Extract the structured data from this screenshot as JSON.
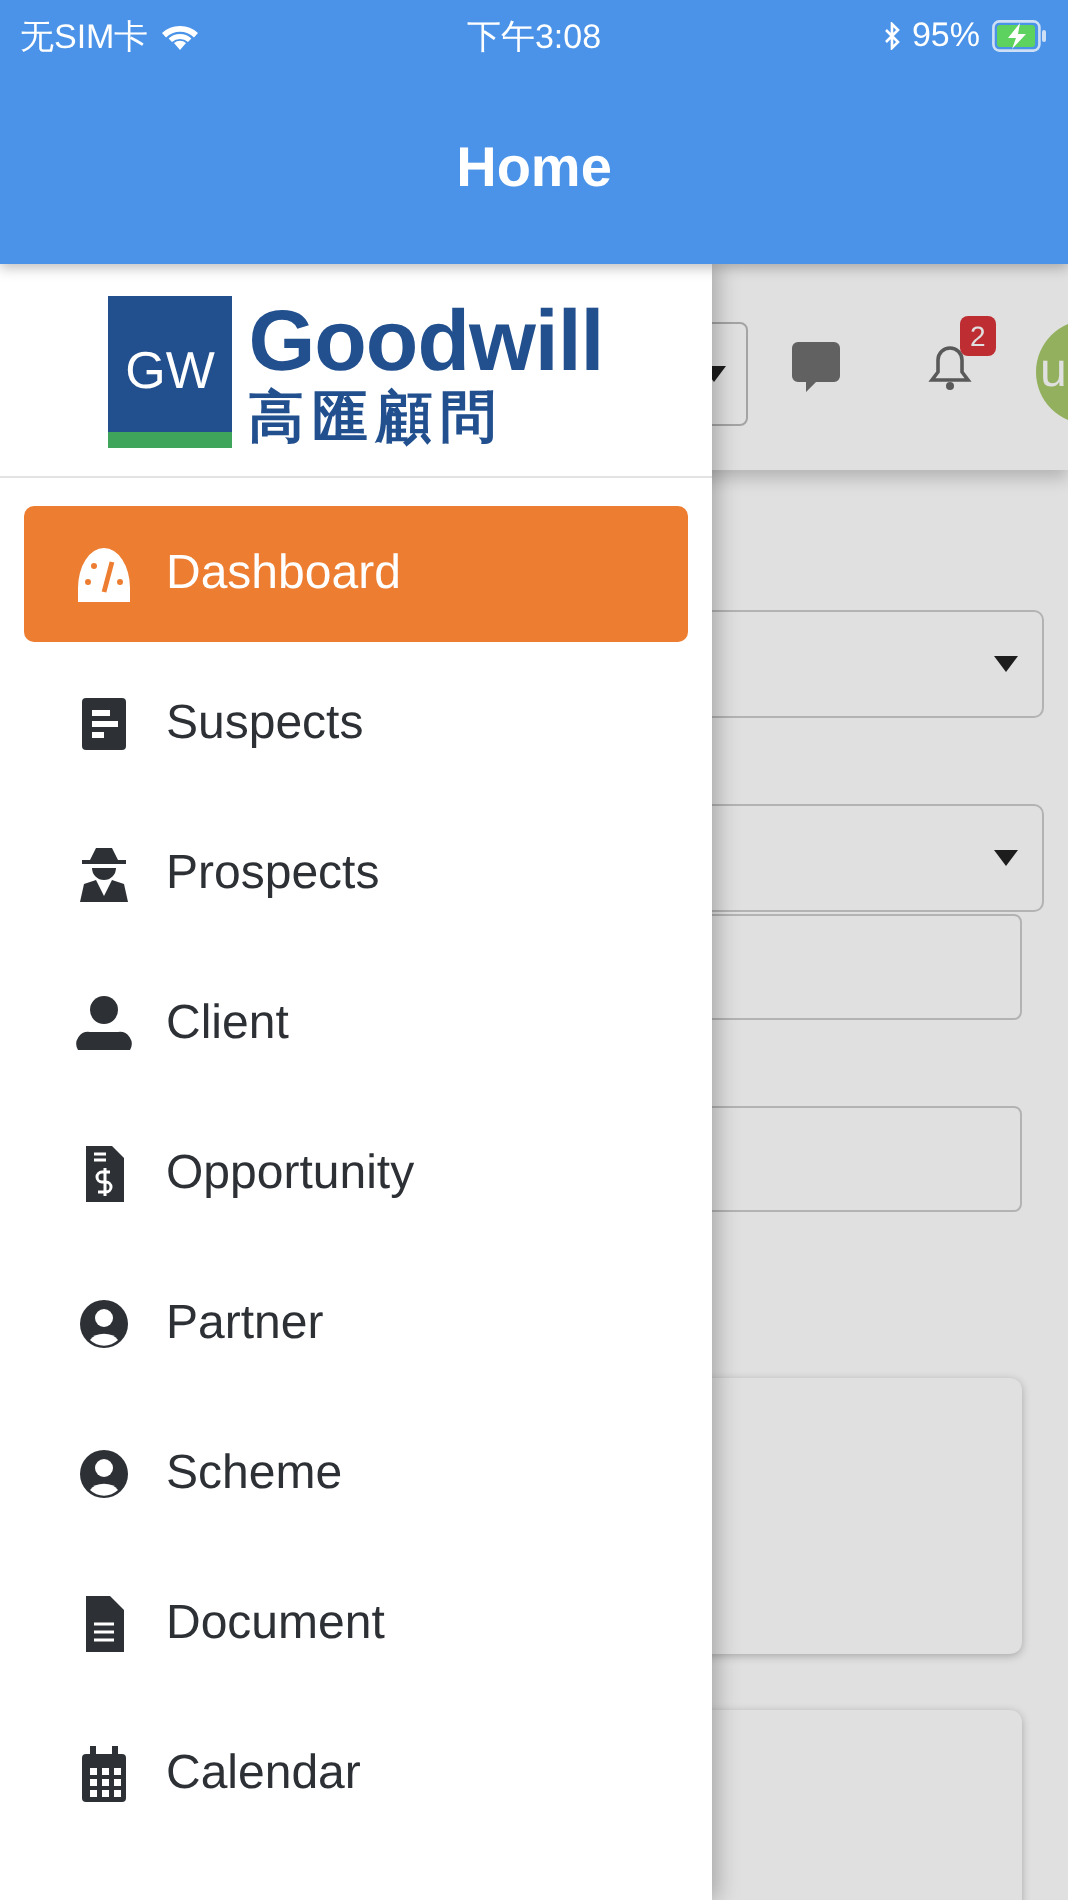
{
  "status_bar": {
    "carrier": "无SIM卡",
    "time": "下午3:08",
    "battery": "95%",
    "charging": true
  },
  "header": {
    "title": "Home"
  },
  "background": {
    "notification_count": "2",
    "avatar_text": "u"
  },
  "drawer": {
    "logo": {
      "badge": "GW",
      "name": "Goodwill",
      "subtitle": "高匯顧問"
    },
    "items": [
      {
        "label": "Dashboard",
        "selected": true
      },
      {
        "label": "Suspects",
        "selected": false
      },
      {
        "label": "Prospects",
        "selected": false
      },
      {
        "label": "Client",
        "selected": false
      },
      {
        "label": "Opportunity",
        "selected": false
      },
      {
        "label": "Partner",
        "selected": false
      },
      {
        "label": "Scheme",
        "selected": false
      },
      {
        "label": "Document",
        "selected": false
      },
      {
        "label": "Calendar",
        "selected": false
      }
    ]
  }
}
